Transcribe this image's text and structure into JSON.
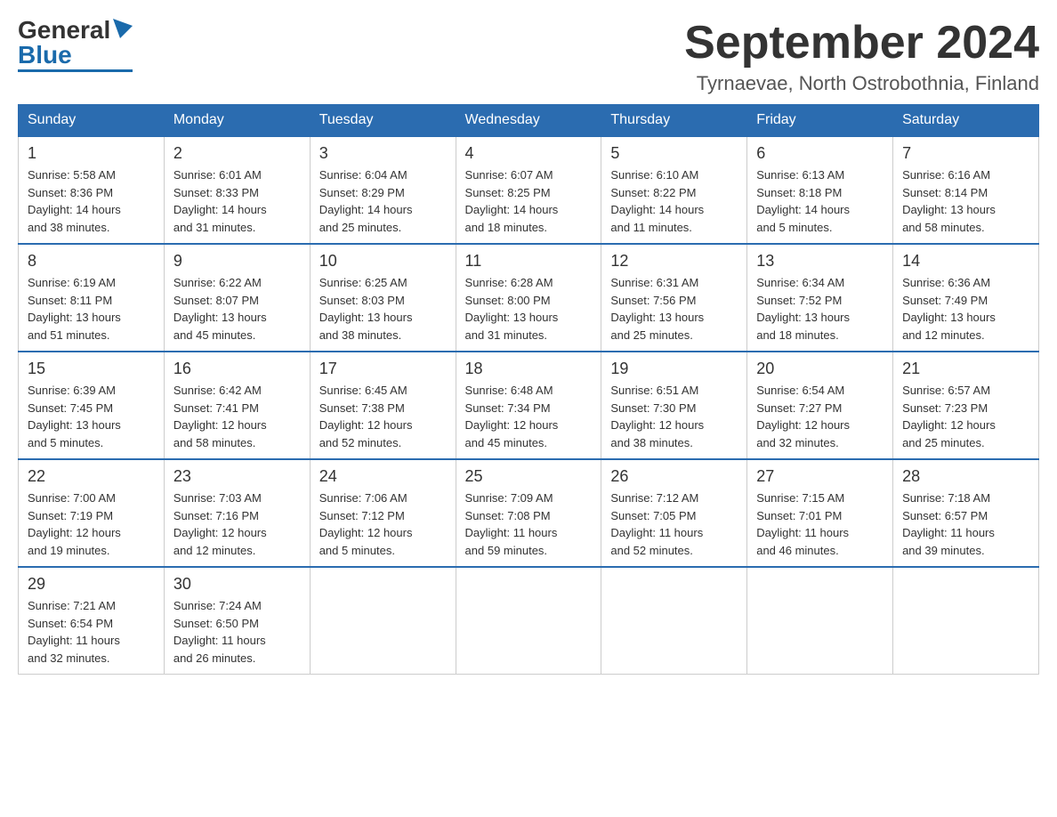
{
  "header": {
    "logo_general": "General",
    "logo_blue": "Blue",
    "month_title": "September 2024",
    "location": "Tyrnaevae, North Ostrobothnia, Finland"
  },
  "weekdays": [
    "Sunday",
    "Monday",
    "Tuesday",
    "Wednesday",
    "Thursday",
    "Friday",
    "Saturday"
  ],
  "weeks": [
    [
      {
        "day": "1",
        "sunrise": "5:58 AM",
        "sunset": "8:36 PM",
        "daylight": "14 hours and 38 minutes."
      },
      {
        "day": "2",
        "sunrise": "6:01 AM",
        "sunset": "8:33 PM",
        "daylight": "14 hours and 31 minutes."
      },
      {
        "day": "3",
        "sunrise": "6:04 AM",
        "sunset": "8:29 PM",
        "daylight": "14 hours and 25 minutes."
      },
      {
        "day": "4",
        "sunrise": "6:07 AM",
        "sunset": "8:25 PM",
        "daylight": "14 hours and 18 minutes."
      },
      {
        "day": "5",
        "sunrise": "6:10 AM",
        "sunset": "8:22 PM",
        "daylight": "14 hours and 11 minutes."
      },
      {
        "day": "6",
        "sunrise": "6:13 AM",
        "sunset": "8:18 PM",
        "daylight": "14 hours and 5 minutes."
      },
      {
        "day": "7",
        "sunrise": "6:16 AM",
        "sunset": "8:14 PM",
        "daylight": "13 hours and 58 minutes."
      }
    ],
    [
      {
        "day": "8",
        "sunrise": "6:19 AM",
        "sunset": "8:11 PM",
        "daylight": "13 hours and 51 minutes."
      },
      {
        "day": "9",
        "sunrise": "6:22 AM",
        "sunset": "8:07 PM",
        "daylight": "13 hours and 45 minutes."
      },
      {
        "day": "10",
        "sunrise": "6:25 AM",
        "sunset": "8:03 PM",
        "daylight": "13 hours and 38 minutes."
      },
      {
        "day": "11",
        "sunrise": "6:28 AM",
        "sunset": "8:00 PM",
        "daylight": "13 hours and 31 minutes."
      },
      {
        "day": "12",
        "sunrise": "6:31 AM",
        "sunset": "7:56 PM",
        "daylight": "13 hours and 25 minutes."
      },
      {
        "day": "13",
        "sunrise": "6:34 AM",
        "sunset": "7:52 PM",
        "daylight": "13 hours and 18 minutes."
      },
      {
        "day": "14",
        "sunrise": "6:36 AM",
        "sunset": "7:49 PM",
        "daylight": "13 hours and 12 minutes."
      }
    ],
    [
      {
        "day": "15",
        "sunrise": "6:39 AM",
        "sunset": "7:45 PM",
        "daylight": "13 hours and 5 minutes."
      },
      {
        "day": "16",
        "sunrise": "6:42 AM",
        "sunset": "7:41 PM",
        "daylight": "12 hours and 58 minutes."
      },
      {
        "day": "17",
        "sunrise": "6:45 AM",
        "sunset": "7:38 PM",
        "daylight": "12 hours and 52 minutes."
      },
      {
        "day": "18",
        "sunrise": "6:48 AM",
        "sunset": "7:34 PM",
        "daylight": "12 hours and 45 minutes."
      },
      {
        "day": "19",
        "sunrise": "6:51 AM",
        "sunset": "7:30 PM",
        "daylight": "12 hours and 38 minutes."
      },
      {
        "day": "20",
        "sunrise": "6:54 AM",
        "sunset": "7:27 PM",
        "daylight": "12 hours and 32 minutes."
      },
      {
        "day": "21",
        "sunrise": "6:57 AM",
        "sunset": "7:23 PM",
        "daylight": "12 hours and 25 minutes."
      }
    ],
    [
      {
        "day": "22",
        "sunrise": "7:00 AM",
        "sunset": "7:19 PM",
        "daylight": "12 hours and 19 minutes."
      },
      {
        "day": "23",
        "sunrise": "7:03 AM",
        "sunset": "7:16 PM",
        "daylight": "12 hours and 12 minutes."
      },
      {
        "day": "24",
        "sunrise": "7:06 AM",
        "sunset": "7:12 PM",
        "daylight": "12 hours and 5 minutes."
      },
      {
        "day": "25",
        "sunrise": "7:09 AM",
        "sunset": "7:08 PM",
        "daylight": "11 hours and 59 minutes."
      },
      {
        "day": "26",
        "sunrise": "7:12 AM",
        "sunset": "7:05 PM",
        "daylight": "11 hours and 52 minutes."
      },
      {
        "day": "27",
        "sunrise": "7:15 AM",
        "sunset": "7:01 PM",
        "daylight": "11 hours and 46 minutes."
      },
      {
        "day": "28",
        "sunrise": "7:18 AM",
        "sunset": "6:57 PM",
        "daylight": "11 hours and 39 minutes."
      }
    ],
    [
      {
        "day": "29",
        "sunrise": "7:21 AM",
        "sunset": "6:54 PM",
        "daylight": "11 hours and 32 minutes."
      },
      {
        "day": "30",
        "sunrise": "7:24 AM",
        "sunset": "6:50 PM",
        "daylight": "11 hours and 26 minutes."
      },
      null,
      null,
      null,
      null,
      null
    ]
  ],
  "labels": {
    "sunrise": "Sunrise:",
    "sunset": "Sunset:",
    "daylight": "Daylight:"
  }
}
